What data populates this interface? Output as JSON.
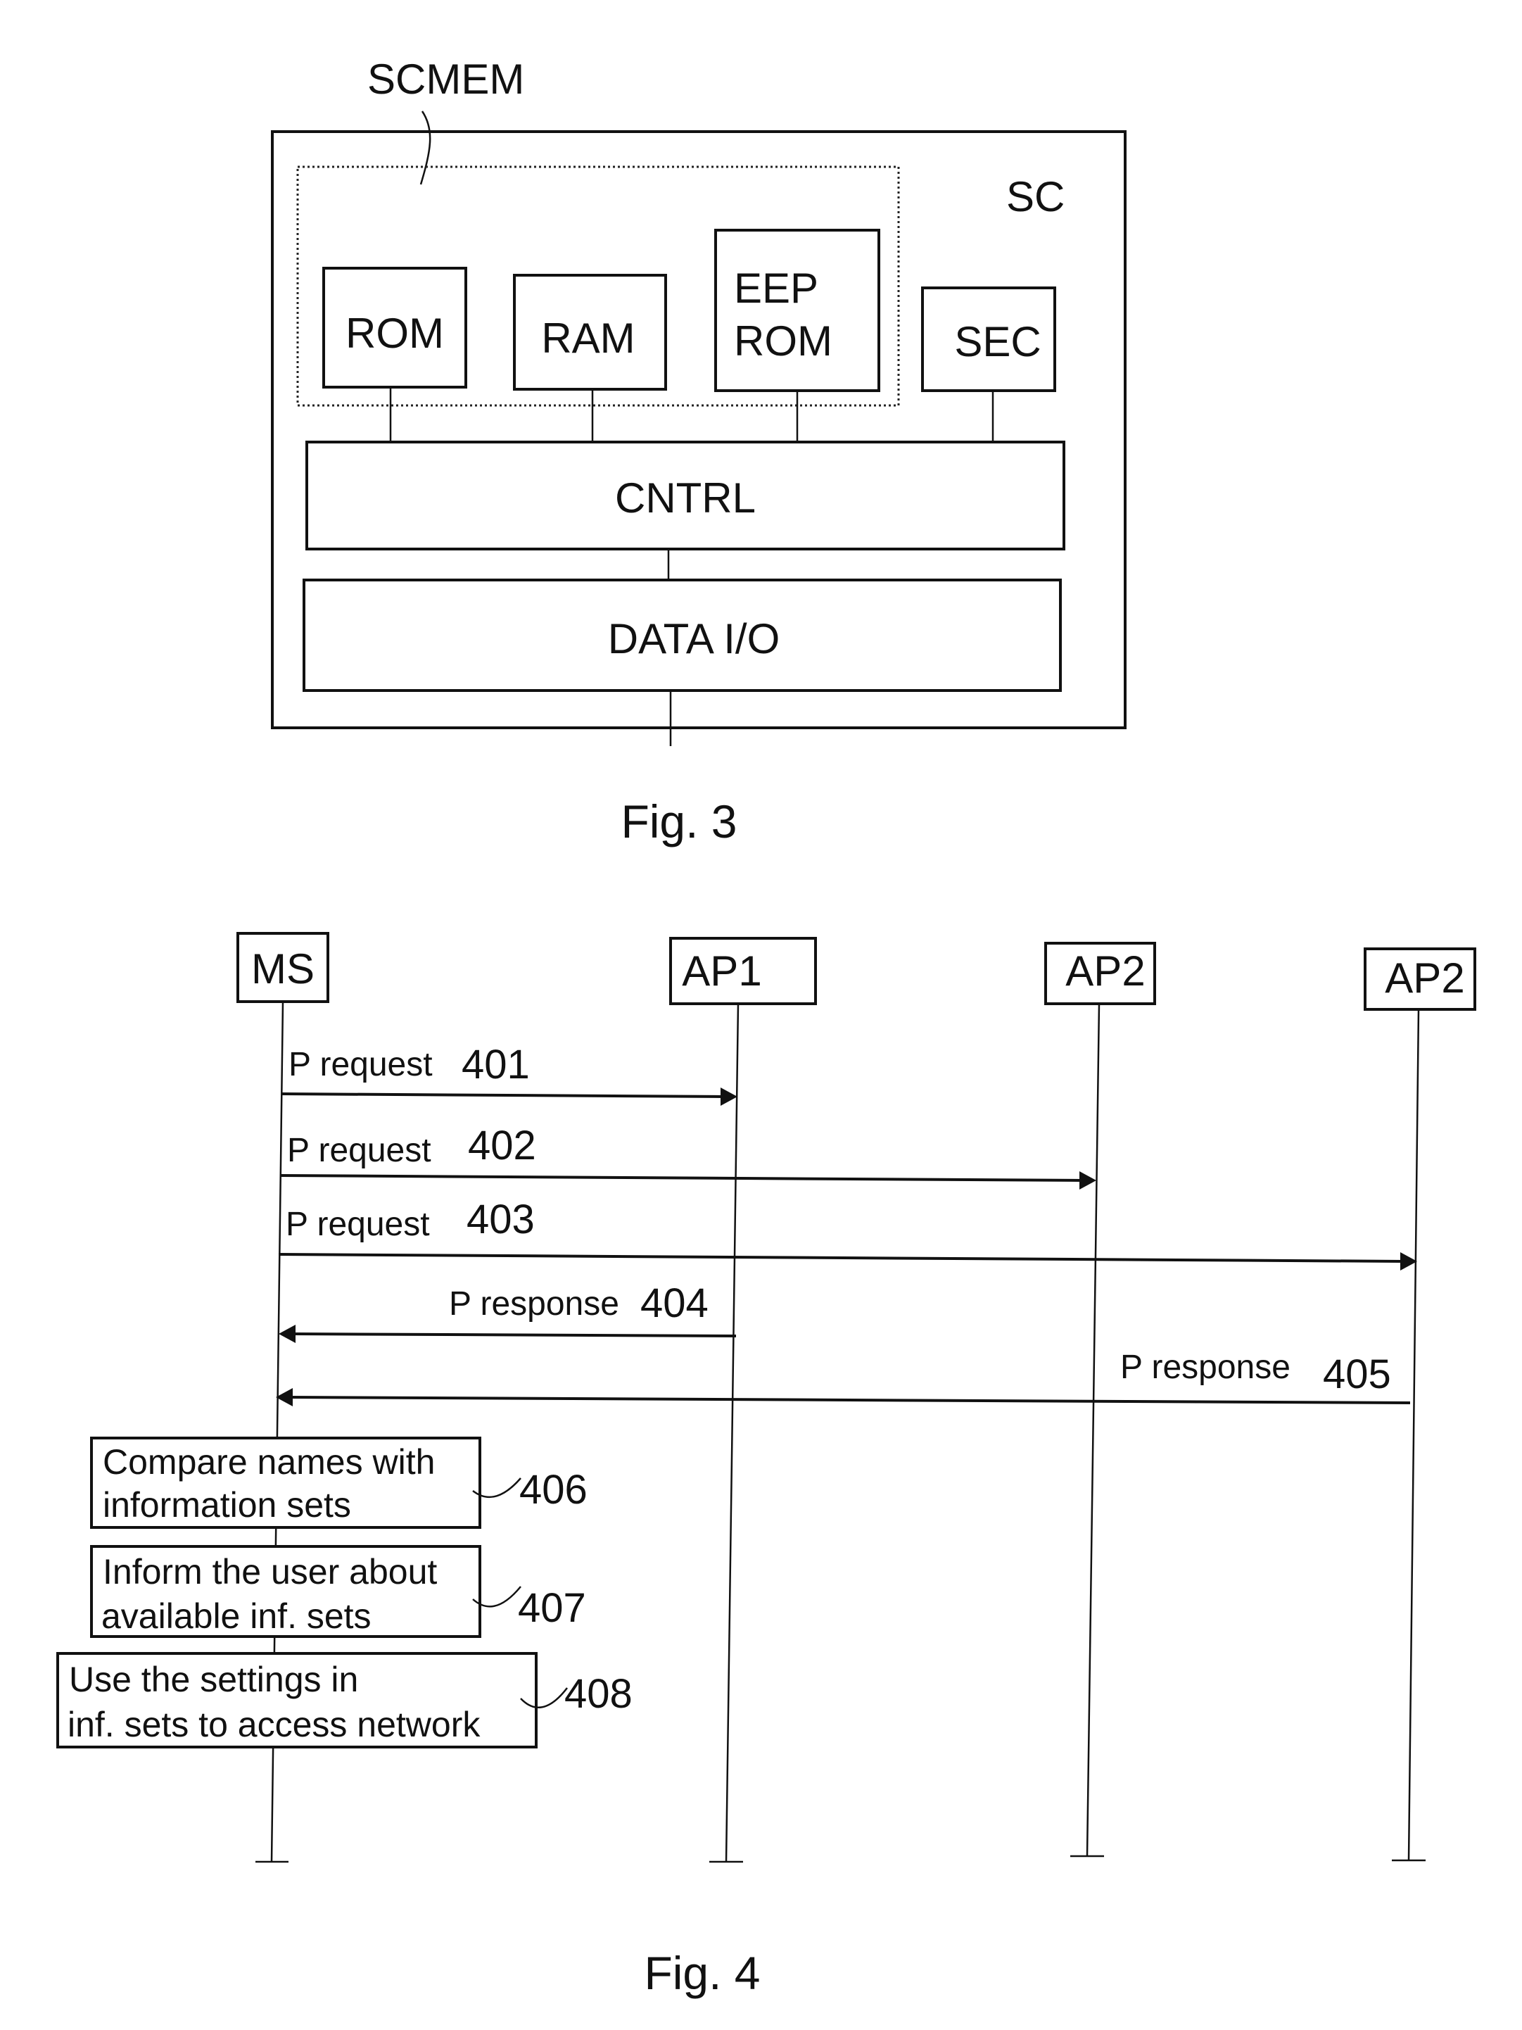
{
  "fig3": {
    "caption": "Fig. 3",
    "outer_label": "SC",
    "memory_group_label": "SCMEM",
    "blocks": {
      "rom": "ROM",
      "ram": "RAM",
      "eeprom_line1": "EEP",
      "eeprom_line2": "ROM",
      "sec": "SEC",
      "cntrl": "CNTRL",
      "data_io": "DATA I/O"
    }
  },
  "fig4": {
    "caption": "Fig. 4",
    "entities": [
      "MS",
      "AP1",
      "AP2",
      "AP2"
    ],
    "messages": [
      {
        "label": "P request",
        "ref": "401",
        "from": "MS",
        "to": "AP1"
      },
      {
        "label": "P request",
        "ref": "402",
        "from": "MS",
        "to": "AP2"
      },
      {
        "label": "P request",
        "ref": "403",
        "from": "MS",
        "to": "AP2 (second)"
      },
      {
        "label": "P response",
        "ref": "404",
        "from": "AP1",
        "to": "MS"
      },
      {
        "label": "P response",
        "ref": "405",
        "from": "AP2 (second)",
        "to": "MS"
      }
    ],
    "steps": [
      {
        "line1": "Compare names with",
        "line2": "information sets",
        "ref": "406"
      },
      {
        "line1": "Inform the user about",
        "line2": "available inf. sets",
        "ref": "407"
      },
      {
        "line1": "Use the settings in",
        "line2": "inf. sets to access network",
        "ref": "408"
      }
    ]
  }
}
